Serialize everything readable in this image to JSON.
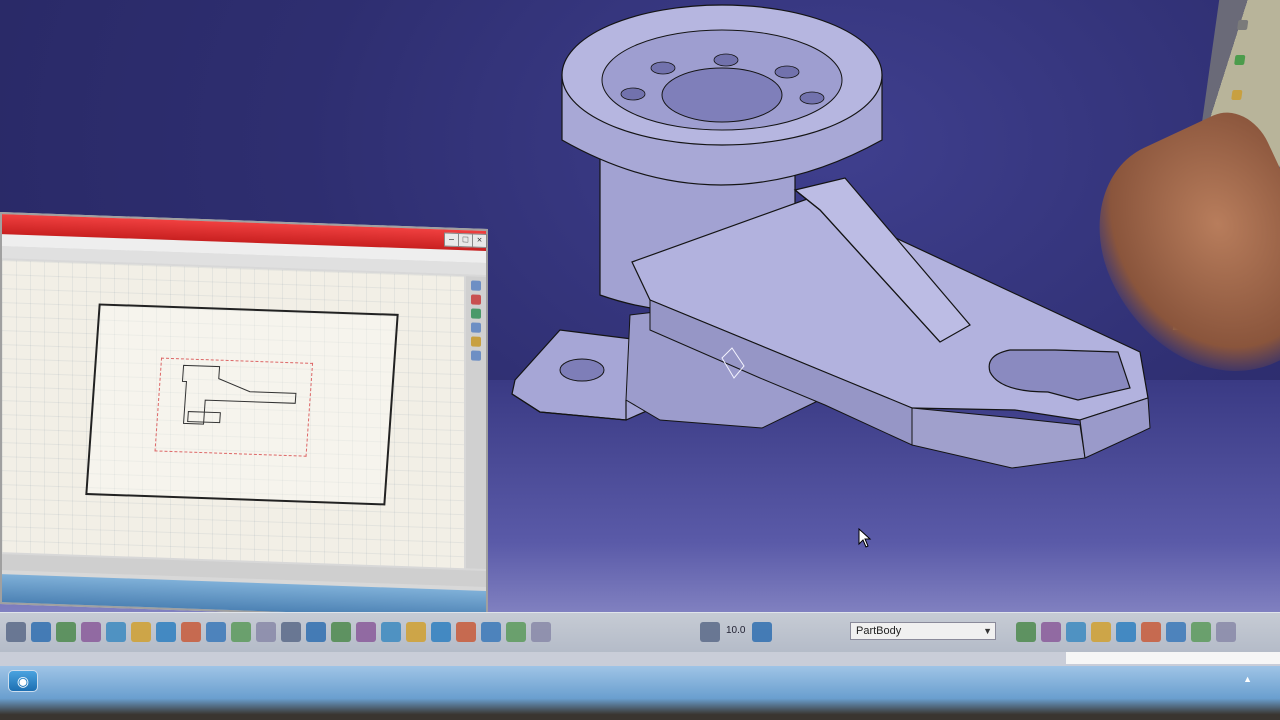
{
  "window": {
    "title": ""
  },
  "drawing_window": {
    "title": "",
    "menu_items": [],
    "clock": {
      "time": "",
      "date": ""
    }
  },
  "viewport": {
    "background": "#2e2e70",
    "part_color": "#a9a9d6",
    "edge_color": "#141414"
  },
  "toolbar": {
    "icons": [
      "sketch-icon",
      "table-icon",
      "constraint-icon",
      "measure-icon",
      "fly-icon",
      "fit-all-icon",
      "pan-icon",
      "rotate-icon",
      "zoom-in-icon",
      "zoom-out-icon",
      "normal-view-icon",
      "iso-view-icon",
      "view-mode-icon",
      "hide-show-icon",
      "swap-icon",
      "shading-icon",
      "render-icon",
      "analysis-icon",
      "pen-icon",
      "camera-icon",
      "undo-icon",
      "update-icon",
      "axis-icon",
      "scale-icon",
      "stack-icon",
      "snap-icon",
      "bodies-icon",
      "part-icon",
      "assembly-icon",
      "material-icon",
      "formula-icon",
      "param-icon",
      "publish-icon"
    ],
    "axis_label": "10.0",
    "body_selector": {
      "selected": "PartBody"
    }
  },
  "colors": {
    "toolbar": "#bcc2ce",
    "titlebar_red": "#e03030",
    "taskbar": "#6a9fcf"
  }
}
